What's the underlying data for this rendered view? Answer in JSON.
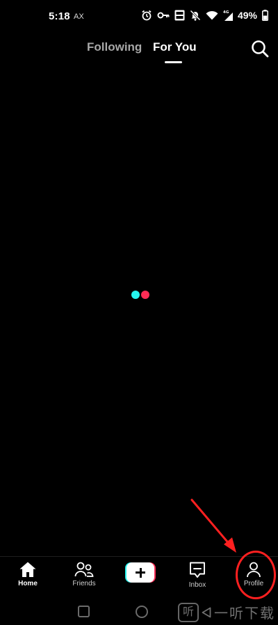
{
  "status_bar": {
    "time": "5:18",
    "carrier": "AX",
    "battery": "49%",
    "icons": [
      "alarm-icon",
      "key-icon",
      "volte-icon",
      "mute-icon",
      "wifi-icon",
      "signal-4g-icon",
      "battery-icon"
    ],
    "network_label": "4G"
  },
  "top_tabs": {
    "following": "Following",
    "for_you": "For You",
    "active": "For You"
  },
  "search": {
    "icon": "search-icon"
  },
  "loader": {
    "colors": {
      "cyan": "#25F4EE",
      "red": "#FE2C55"
    }
  },
  "bottom_nav": {
    "items": [
      {
        "label": "Home",
        "icon": "home-icon"
      },
      {
        "label": "Friends",
        "icon": "friends-icon"
      },
      {
        "label": "",
        "icon": "plus-icon"
      },
      {
        "label": "Inbox",
        "icon": "inbox-icon"
      },
      {
        "label": "Profile",
        "icon": "profile-icon"
      }
    ],
    "active": "Home"
  },
  "annotation": {
    "color": "#ff2020",
    "target": "Profile"
  },
  "watermark": {
    "logo": "听",
    "text": "一听下载"
  }
}
